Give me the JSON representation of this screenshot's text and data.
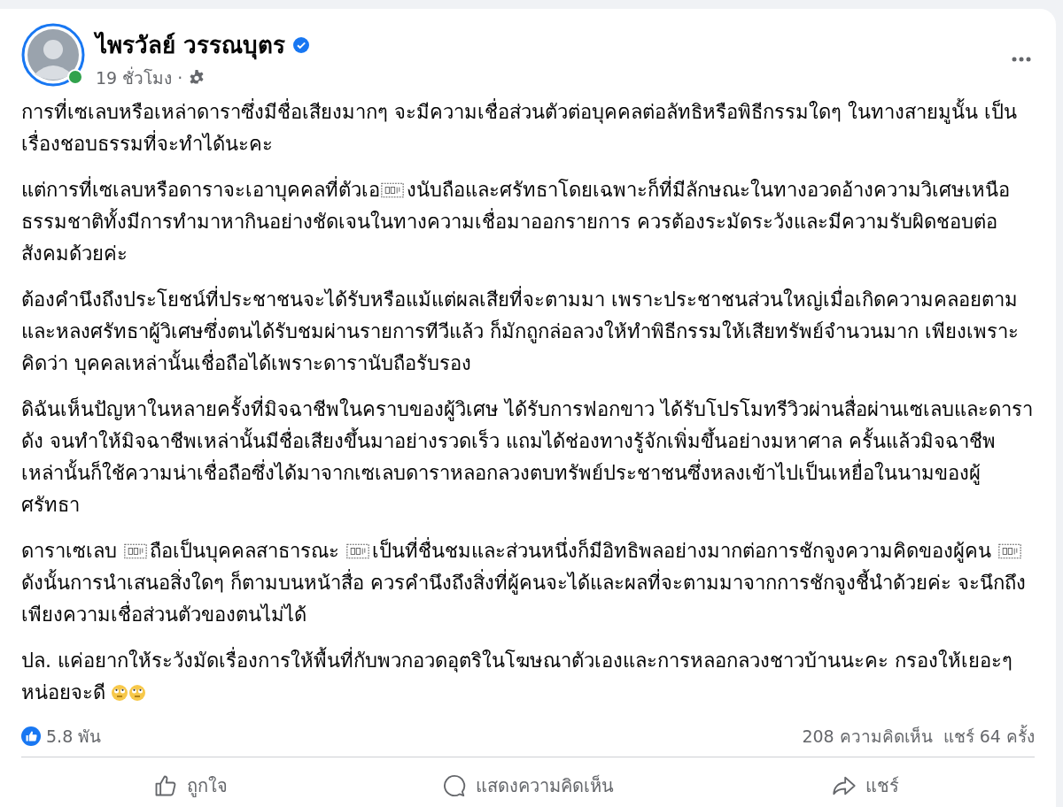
{
  "author": {
    "name": "ไพรวัลย์ วรรณบุตร",
    "verified": true,
    "online": true
  },
  "meta": {
    "time": "19 ชั่วโมง ·"
  },
  "paragraphs": [
    {
      "text": "การที่เซเลบหรือเหล่าดาราซึ่งมีชื่อเสียงมากๆ จะมีความเชื่อส่วนตัวต่อบุคคลต่อลัทธิหรือพิธีกรรมใดๆ ในทางสายมูนั้น เป็นเรื่องชอบธรรมที่จะทำได้นะคะ"
    },
    {
      "parts": [
        "แต่การที่เซเลบหรือดาราจะเอาบุคคลที่ตัวเอ",
        "งนับถือและศรัทธาโดยเฉพาะก็ที่มีลักษณะในทางอวดอ้างความวิเศษเหนือธรรมชาติทั้งมีการทำมาหากินอย่างชัดเจนในทางความเชื่อมาออกรายการ ควรต้องระมัดระวังและมีความรับผิดชอบต่อสังคมด้วยค่ะ"
      ]
    },
    {
      "text": "ต้องคำนึงถึงประโยชน์ที่ประชาชนจะได้รับหรือแม้แต่ผลเสียที่จะตามมา เพราะประชาชนส่วนใหญ่เมื่อเกิดความคลอยตามและหลงศรัทธาผู้วิเศษซึ่งตนได้รับชมผ่านรายการทีวีแล้ว ก็มักถูกล่อลวงให้ทำพิธีกรรมให้เสียทรัพย์จำนวนมาก เพียงเพราะคิดว่า บุคคลเหล่านั้นเชื่อถือได้เพราะดารานับถือรับรอง"
    },
    {
      "text": "ดิฉันเห็นปัญหาในหลายครั้งที่มิจฉาชีพในคราบของผู้วิเศษ ได้รับการฟอกขาว ได้รับโปรโมทรีวิวผ่านสื่อผ่านเซเลบและดาราดัง จนทำให้มิจฉาชีพเหล่านั้นมีชื่อเสียงขึ้นมาอย่างรวดเร็ว แถมได้ช่องทางรู้จักเพิ่มขึ้นอย่างมหาศาล ครั้นแล้วมิจฉาชีพเหล่านั้นก็ใช้ความน่าเชื่อถือซึ่งได้มาจากเซเลบดาราหลอกลวงตบทรัพย์ประชาชนซึ่งหลงเข้าไปเป็นเหยื่อในนามของผู้ศรัทธา"
    },
    {
      "parts": [
        "ดาราเซเลบ ",
        "ถือเป็นบุคคลสาธารณะ ",
        "เป็นที่ชื่นชมและส่วนหนึ่งก็มีอิทธิพลอย่างมากต่อการชักจูงความคิดของผู้คน ",
        "ดังนั้นการนำเสนอสิ่งใดๆ ก็ตามบนหน้าสื่อ ควรคำนึงถึงสิ่งที่ผู้คนจะได้และผลที่จะตามมาจากการชักจูงชี้นำด้วยค่ะ จะนึกถึงเพียงความเชื่อส่วนตัวของตนไม่ได้"
      ]
    },
    {
      "text": "ปล. แค่อยากให้ระวังมัดเรื่องการให้พื้นที่กับพวกอวดอุตริในโฆษณาตัวเองและการหลอกลวงชาวบ้านนะคะ กรองให้เยอะๆ หน่อยจะดี",
      "trailing_emoji": true
    }
  ],
  "stats": {
    "reactions": "5.8 พัน",
    "comments": "208 ความคิดเห็น",
    "shares": "แชร์ 64 ครั้ง"
  },
  "actions": [
    {
      "kind": "like",
      "label": "ถูกใจ"
    },
    {
      "kind": "comment",
      "label": "แสดงความคิดเห็น"
    },
    {
      "kind": "share",
      "label": "แชร์"
    }
  ]
}
